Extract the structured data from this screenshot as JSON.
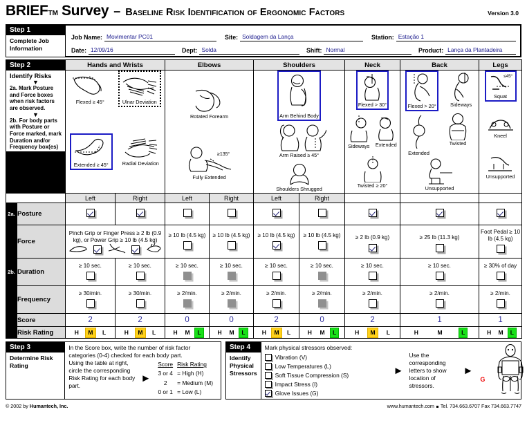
{
  "title": {
    "main": "BRIEF",
    "tm": "TM",
    "word": "Survey",
    "dash": "–",
    "subtitle": "Baseline Risk Identification of Ergonomic Factors",
    "version": "Version 3.0"
  },
  "step1": {
    "step_label": "Step 1",
    "description": "Complete Job Information",
    "fields": [
      {
        "label": "Job Name:",
        "value": "Movimentar PC01"
      },
      {
        "label": "Site:",
        "value": "Soldagem da Lança"
      },
      {
        "label": "Station:",
        "value": "Estação 1"
      },
      {
        "label": "Date:",
        "value": "12/09/16"
      },
      {
        "label": "Dept:",
        "value": "Solda"
      },
      {
        "label": "Shift:",
        "value": "Normal"
      },
      {
        "label": "Product:",
        "value": "Lança da Plantadeira"
      }
    ]
  },
  "step2": {
    "step_label": "Step 2",
    "heading": "Identify Risks",
    "instr_a": "2a. Mark Posture and Force boxes when risk factors are observed.",
    "instr_b": "2b. For body parts with Posture or Force marked, mark Duration and/or Frequency box(es) when limits are exceeded.",
    "tag_2a": "2a.",
    "tag_2b": "2b.",
    "body_parts": [
      "Hands and Wrists",
      "Elbows",
      "Shoulders",
      "Neck",
      "Back",
      "Legs"
    ],
    "side_labels": [
      "Left",
      "Right",
      "Left",
      "Right",
      "Left",
      "Right"
    ],
    "figures": {
      "hands": [
        {
          "caption": "Flexed ≥ 45°",
          "highlight": "none"
        },
        {
          "caption": "Ulnar Deviation",
          "highlight": "dashed"
        },
        {
          "caption": "Extended ≥ 45°",
          "highlight": "blue"
        },
        {
          "caption": "Radial Deviation",
          "highlight": "none"
        }
      ],
      "elbows": [
        {
          "caption": "Rotated Forearm",
          "highlight": "none"
        },
        {
          "caption": "Fully Extended",
          "highlight": "none"
        }
      ],
      "shoulders": [
        {
          "caption": "Arm Behind Body",
          "highlight": "blue"
        },
        {
          "caption": "Arm Raised ≥ 45°",
          "highlight": "none"
        },
        {
          "caption": "Shoulders Shrugged",
          "highlight": "none"
        }
      ],
      "neck": [
        {
          "caption": "Flexed > 30°",
          "highlight": "blue"
        },
        {
          "caption": "Sideways",
          "highlight": "none"
        },
        {
          "caption": "Extended",
          "highlight": "none"
        },
        {
          "caption": "Twisted ≥ 20°",
          "highlight": "none"
        }
      ],
      "back": [
        {
          "caption": "Flexed > 20°",
          "highlight": "blue"
        },
        {
          "caption": "Sideways",
          "highlight": "none"
        },
        {
          "caption": "Extended",
          "highlight": "none"
        },
        {
          "caption": "Twisted",
          "highlight": "none"
        },
        {
          "caption": "Unsupported",
          "highlight": "none"
        }
      ],
      "legs": [
        {
          "caption": "Squat",
          "highlight": "blue"
        },
        {
          "caption": "Kneel",
          "highlight": "none"
        },
        {
          "caption": "Unsupported",
          "highlight": "none"
        }
      ]
    },
    "rows": {
      "posture_label": "Posture",
      "force_label": "Force",
      "duration_label": "Duration",
      "frequency_label": "Frequency",
      "score_label": "Score",
      "risk_label": "Risk Rating"
    },
    "posture": [
      {
        "col": "hands-left",
        "state": "checked"
      },
      {
        "col": "hands-right",
        "state": "checked"
      },
      {
        "col": "elbows-left",
        "state": "unchecked"
      },
      {
        "col": "elbows-right",
        "state": "unchecked"
      },
      {
        "col": "shoulders-left",
        "state": "checked"
      },
      {
        "col": "shoulders-right",
        "state": "unchecked"
      },
      {
        "col": "neck",
        "state": "checked"
      },
      {
        "col": "back",
        "state": "checked"
      },
      {
        "col": "legs",
        "state": "checked"
      }
    ],
    "force": {
      "hands_text": "Pinch Grip or Finger Press ≥ 2 lb (0.9 kg), or Power Grip ≥ 10 lb (4.5 kg)",
      "hands_left_state": "checked",
      "hands_right_state": "checked",
      "cells": [
        {
          "col": "elbows-left",
          "text": "≥ 10 lb (4.5 kg)",
          "state": "unchecked"
        },
        {
          "col": "elbows-right",
          "text": "≥ 10 lb (4.5 kg)",
          "state": "unchecked"
        },
        {
          "col": "shoulders-left",
          "text": "≥ 10 lb (4.5 kg)",
          "state": "checked"
        },
        {
          "col": "shoulders-right",
          "text": "≥ 10 lb (4.5 kg)",
          "state": "unchecked"
        },
        {
          "col": "neck",
          "text": "≥ 2 lb (0.9 kg)",
          "state": "checked"
        },
        {
          "col": "back",
          "text": "≥ 25 lb (11.3 kg)",
          "state": "unchecked"
        },
        {
          "col": "legs",
          "text": "Foot Pedal ≥ 10 lb (4.5 kg)",
          "state": "unchecked"
        }
      ]
    },
    "duration": [
      {
        "col": "hands-left",
        "text": "≥ 10 sec.",
        "state": "unchecked"
      },
      {
        "col": "hands-right",
        "text": "≥ 10 sec.",
        "state": "unchecked"
      },
      {
        "col": "elbows-left",
        "text": "≥ 10 sec.",
        "state": "disabled"
      },
      {
        "col": "elbows-right",
        "text": "≥ 10 sec.",
        "state": "disabled"
      },
      {
        "col": "shoulders-left",
        "text": "≥ 10 sec.",
        "state": "unchecked"
      },
      {
        "col": "shoulders-right",
        "text": "≥ 10 sec.",
        "state": "disabled"
      },
      {
        "col": "neck",
        "text": "≥ 10 sec.",
        "state": "unchecked"
      },
      {
        "col": "back",
        "text": "≥ 10 sec.",
        "state": "unchecked"
      },
      {
        "col": "legs",
        "text": "≥ 30% of day",
        "state": "unchecked"
      }
    ],
    "frequency": [
      {
        "col": "hands-left",
        "text": "≥ 30/min.",
        "state": "unchecked"
      },
      {
        "col": "hands-right",
        "text": "≥ 30/min.",
        "state": "unchecked"
      },
      {
        "col": "elbows-left",
        "text": "≥ 2/min.",
        "state": "disabled"
      },
      {
        "col": "elbows-right",
        "text": "≥ 2/min.",
        "state": "disabled"
      },
      {
        "col": "shoulders-left",
        "text": "≥ 2/min.",
        "state": "unchecked"
      },
      {
        "col": "shoulders-right",
        "text": "≥ 2/min.",
        "state": "disabled"
      },
      {
        "col": "neck",
        "text": "≥ 2/min.",
        "state": "unchecked"
      },
      {
        "col": "back",
        "text": "≥ 2/min.",
        "state": "unchecked"
      },
      {
        "col": "legs",
        "text": "≥ 2/min.",
        "state": "unchecked"
      }
    ],
    "scores": [
      "2",
      "2",
      "0",
      "0",
      "2",
      "0",
      "2",
      "1",
      "1"
    ],
    "risk_ratings": [
      {
        "col": "hands-left",
        "options": [
          "H",
          "M",
          "L"
        ],
        "selected": "M"
      },
      {
        "col": "hands-right",
        "options": [
          "H",
          "M",
          "L"
        ],
        "selected": "M"
      },
      {
        "col": "elbows-left",
        "options": [
          "H",
          "M",
          "L"
        ],
        "selected": "L"
      },
      {
        "col": "elbows-right",
        "options": [
          "H",
          "M",
          "L"
        ],
        "selected": "L"
      },
      {
        "col": "shoulders-left",
        "options": [
          "H",
          "M",
          "L"
        ],
        "selected": "M"
      },
      {
        "col": "shoulders-right",
        "options": [
          "H",
          "M",
          "L"
        ],
        "selected": "L"
      },
      {
        "col": "neck",
        "options": [
          "H",
          "M",
          "L"
        ],
        "selected": "M"
      },
      {
        "col": "back",
        "options": [
          "H",
          "M",
          "L"
        ],
        "selected": "L"
      },
      {
        "col": "legs",
        "options": [
          "H",
          "M",
          "L"
        ],
        "selected": "L"
      }
    ]
  },
  "step3": {
    "step_label": "Step 3",
    "description": "Determine Risk Rating",
    "para1": "In the Score box, write the number of risk factor categories (0-4) checked for each body part.",
    "para2": "Using the table at right, circle the corresponding Risk Rating for each body part.",
    "table_head": [
      "Score",
      "Risk Rating"
    ],
    "table_rows": [
      {
        "score": "3 or 4",
        "eq": "=",
        "rating": "High (H)"
      },
      {
        "score": "2",
        "eq": "=",
        "rating": "Medium (M)"
      },
      {
        "score": "0 or 1",
        "eq": "=",
        "rating": "Low (L)"
      }
    ]
  },
  "step4": {
    "step_label": "Step 4",
    "description": "Identify Physical Stressors",
    "prompt": "Mark physical stressors observed:",
    "stressors": [
      {
        "label": "Vibration (V)",
        "state": "unchecked"
      },
      {
        "label": "Low Temperatures (L)",
        "state": "unchecked"
      },
      {
        "label": "Soft Tissue Compression (S)",
        "state": "unchecked"
      },
      {
        "label": "Impact Stress (I)",
        "state": "unchecked"
      },
      {
        "label": "Glove Issues (G)",
        "state": "checked"
      }
    ],
    "use_text": "Use the corresponding letters to show location of stressors.",
    "body_marks": [
      {
        "letter": "G",
        "side": "left",
        "color": "#ee0000"
      },
      {
        "letter": "G",
        "side": "right",
        "color": "#ee0000"
      }
    ]
  },
  "footer": {
    "copyright_prefix": "© 2002 by ",
    "copyright_company": "Humantech, Inc.",
    "website": "www.humantech.com",
    "contact": "Tel. 734.663.6707   Fax 734.663.7747"
  }
}
